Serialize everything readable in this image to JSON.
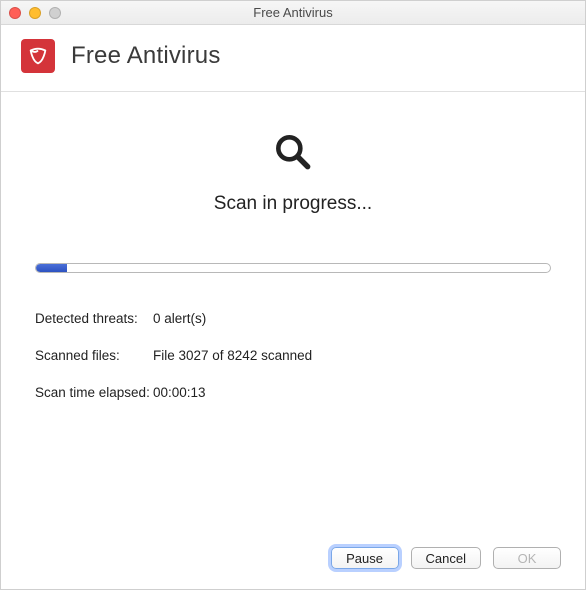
{
  "titlebar": {
    "title": "Free Antivirus"
  },
  "header": {
    "title": "Free Antivirus"
  },
  "scan": {
    "status_text": "Scan in progress...",
    "progress_percent": 6
  },
  "stats": {
    "detected_label": "Detected threats:",
    "detected_value": "0 alert(s)",
    "scanned_label": "Scanned files:",
    "scanned_value": "File 3027 of 8242 scanned",
    "elapsed_label": "Scan time elapsed:",
    "elapsed_value": "00:00:13"
  },
  "buttons": {
    "pause": "Pause",
    "cancel": "Cancel",
    "ok": "OK"
  }
}
